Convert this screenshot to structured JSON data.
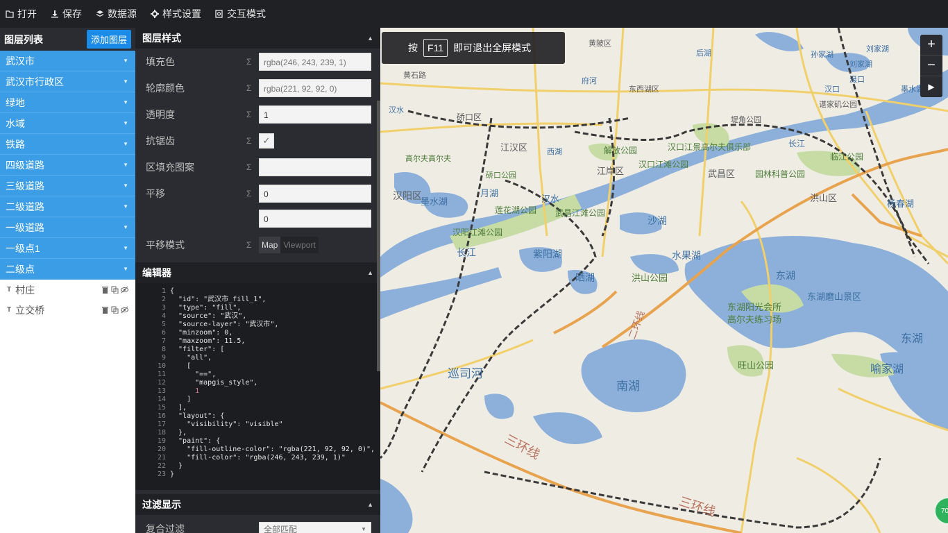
{
  "toolbar": {
    "open": "打开",
    "save": "保存",
    "datasource": "数据源",
    "style_settings": "样式设置",
    "interact_mode": "交互模式"
  },
  "layer_panel": {
    "title": "图层列表",
    "add_button": "添加图层",
    "layers": [
      "武汉市",
      "武汉市行政区",
      "绿地",
      "水域",
      "铁路",
      "四级道路",
      "三级道路",
      "二级道路",
      "一级道路",
      "一级点1",
      "二级点"
    ],
    "symbol_layers": [
      "村庄",
      "立交桥"
    ]
  },
  "style_panel": {
    "title": "图层样式",
    "fields": {
      "fill_color": {
        "label": "填充色",
        "value": "rgba(246, 243, 239, 1)"
      },
      "outline_color": {
        "label": "轮廓颜色",
        "value": "rgba(221, 92, 92, 0)"
      },
      "opacity": {
        "label": "透明度",
        "value": "1"
      },
      "antialias": {
        "label": "抗锯齿"
      },
      "fill_pattern": {
        "label": "区填充图案",
        "value": ""
      },
      "translate": {
        "label": "平移",
        "x": "0",
        "y": "0"
      },
      "translate_anchor": {
        "label": "平移模式",
        "options": [
          "Map",
          "Viewport"
        ],
        "selected": "Map"
      }
    },
    "sigma": "Σ"
  },
  "editor": {
    "title": "编辑器",
    "lines": [
      "{",
      "  \"id\": \"武汉市_fill_1\",",
      "  \"type\": \"fill\",",
      "  \"source\": \"武汉\",",
      "  \"source-layer\": \"武汉市\",",
      "  \"minzoom\": 0,",
      "  \"maxzoom\": 11.5,",
      "  \"filter\": [",
      "    \"all\",",
      "    [",
      "      \"==\",",
      "      \"mapgis_style\",",
      "      1",
      "    ]",
      "  ],",
      "  \"layout\": {",
      "    \"visibility\": \"visible\"",
      "  },",
      "  \"paint\": {",
      "    \"fill-outline-color\": \"rgba(221, 92, 92, 0)\",",
      "    \"fill-color\": \"rgba(246, 243, 239, 1)\"",
      "  }",
      "}"
    ]
  },
  "filter_panel": {
    "title": "过滤显示",
    "compound_label": "复合过滤",
    "compound_value": "全部匹配"
  },
  "map": {
    "fullscreen_notice": {
      "prefix": "按",
      "key": "F11",
      "suffix": "即可退出全屏模式"
    },
    "zoom_in": "+",
    "zoom_out": "−",
    "badge": "70",
    "labels": [
      {
        "text": "黄陂区"
      },
      {
        "text": "后湖"
      },
      {
        "text": "东西湖区"
      },
      {
        "text": "府河"
      },
      {
        "text": "黄石路"
      },
      {
        "text": "汉水"
      },
      {
        "text": "硚口区"
      },
      {
        "text": "江汉区"
      },
      {
        "text": "西湖"
      },
      {
        "text": "解放公园"
      },
      {
        "text": "堤角公园"
      },
      {
        "text": "汉口江景高尔夫俱乐部"
      },
      {
        "text": "长江"
      },
      {
        "text": "临江公园"
      },
      {
        "text": "高尔夫高尔夫"
      },
      {
        "text": "硚口公园"
      },
      {
        "text": "汉阳区"
      },
      {
        "text": "月湖"
      },
      {
        "text": "墨水湖"
      },
      {
        "text": "莲花湖公园"
      },
      {
        "text": "汉水"
      },
      {
        "text": "武昌江滩公园"
      },
      {
        "text": "汉阳江滩公园"
      },
      {
        "text": "江岸区"
      },
      {
        "text": "汉口江滩公园"
      },
      {
        "text": "武昌区"
      },
      {
        "text": "园林科普公园"
      },
      {
        "text": "洪山区"
      },
      {
        "text": "杨春湖"
      },
      {
        "text": "长江"
      },
      {
        "text": "紫阳湖"
      },
      {
        "text": "沙湖"
      },
      {
        "text": "水果湖"
      },
      {
        "text": "晒湖"
      },
      {
        "text": "洪山公园"
      },
      {
        "text": "东湖"
      },
      {
        "text": "东湖磨山景区"
      },
      {
        "text": "东湖阳光会所"
      },
      {
        "text": "高尔夫练习场"
      },
      {
        "text": "东湖"
      },
      {
        "text": "巡司河"
      },
      {
        "text": "南湖"
      },
      {
        "text": "旺山公园"
      },
      {
        "text": "喻家湖"
      },
      {
        "text": "三环线"
      },
      {
        "text": "三环线"
      },
      {
        "text": "二环线"
      },
      {
        "text": "谌家矶公园"
      },
      {
        "text": "汉口"
      },
      {
        "text": "刘家湖"
      },
      {
        "text": "滠口"
      },
      {
        "text": "刘家湖"
      },
      {
        "text": "孙家湖"
      },
      {
        "text": "墨水湖"
      }
    ]
  },
  "colors": {
    "toolbar_bg": "#1f2125",
    "layer_item_bg": "#3a9de6",
    "add_button_bg": "#1a8be6",
    "panel_bg": "#2a2c31",
    "map_land": "#efece4",
    "map_water": "#8cb0d9",
    "map_green": "#c6dca4",
    "road_yellow": "#f1cf6a",
    "road_orange": "#e8a34f"
  }
}
